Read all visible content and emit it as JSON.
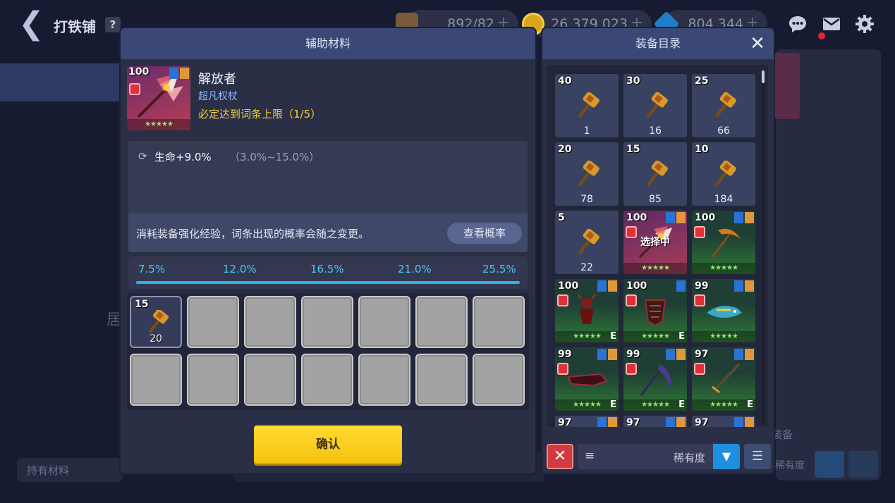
{
  "header": {
    "title": "打铁铺",
    "help": "?",
    "resources": {
      "stamina": "892/82",
      "gold": "26 379 023",
      "gems": "804 344"
    },
    "plus": "+"
  },
  "background": {
    "left_ghost_text": "居",
    "hold_materials": "持有材料",
    "right_label": "装备",
    "right_rarity": "稀有度"
  },
  "aux_modal": {
    "title": "辅助材料",
    "item": {
      "level": "100",
      "name": "解放者",
      "type": "超凡权杖",
      "note": "必定达到词条上限（1/5）",
      "stars": "★★★★★"
    },
    "attribute": {
      "main": "生命+9.0%",
      "range": "（3.0%~15.0%）"
    },
    "notice": "消耗装备强化经验，词条出现的概率会随之变更。",
    "view_prob_button": "查看概率",
    "probabilities": [
      "7.5%",
      "12.0%",
      "16.5%",
      "21.0%",
      "25.5%"
    ],
    "filled_slot": {
      "level": "15",
      "count": "20"
    },
    "confirm_button": "确认"
  },
  "catalog_modal": {
    "title": "装备目录",
    "close": "✕",
    "materials": [
      {
        "level": "40",
        "count": "1"
      },
      {
        "level": "30",
        "count": "16"
      },
      {
        "level": "25",
        "count": "66"
      },
      {
        "level": "20",
        "count": "78"
      },
      {
        "level": "15",
        "count": "85"
      },
      {
        "level": "10",
        "count": "184"
      },
      {
        "level": "5",
        "count": "22"
      }
    ],
    "equipment": [
      {
        "level": "100",
        "selected_label": "选择中",
        "stars": "★★★★★"
      },
      {
        "level": "100",
        "stars": "★★★★★"
      },
      {
        "level": "100",
        "stars": "★★★★★",
        "tag": "E"
      },
      {
        "level": "100",
        "stars": "★★★★★",
        "tag": "E"
      },
      {
        "level": "99",
        "stars": "★★★★★"
      },
      {
        "level": "99",
        "stars": "★★★★★",
        "tag": "E"
      },
      {
        "level": "99",
        "stars": "★★★★★",
        "tag": "E"
      },
      {
        "level": "97",
        "stars": "★★★★★",
        "tag": "E"
      },
      {
        "level": "97"
      },
      {
        "level": "97"
      },
      {
        "level": "97"
      }
    ],
    "sort_label": "稀有度"
  },
  "colors": {
    "accent_yellow": "#f5c518",
    "probability_blue": "#4cc7f0",
    "header_blue": "#3b4774",
    "lock_red": "#e0303b"
  }
}
